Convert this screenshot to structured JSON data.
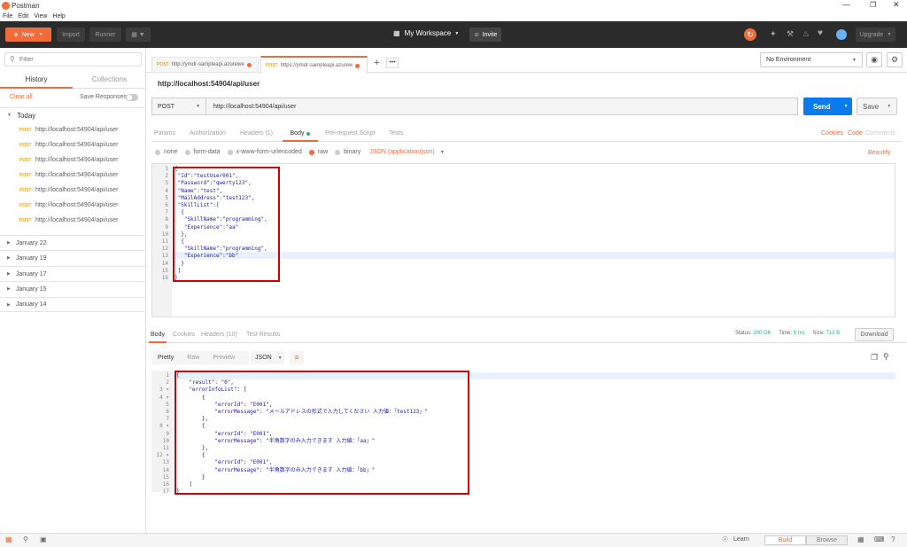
{
  "window": {
    "title": "Postman"
  },
  "menu": [
    "File",
    "Edit",
    "View",
    "Help"
  ],
  "header": {
    "new_label": "New",
    "import_label": "Import",
    "runner_label": "Runner",
    "workspace_label": "My Workspace",
    "invite_label": "Invite",
    "upgrade_label": "Upgrade"
  },
  "sidebar": {
    "search_placeholder": "Filter",
    "tabs": [
      "History",
      "Collections"
    ],
    "clear_all": "Clear all",
    "save_responses": "Save Responses",
    "today": "Today",
    "items": [
      {
        "method": "POST",
        "url": "http://localhost:54904/api/user"
      },
      {
        "method": "POST",
        "url": "http://localhost:54904/api/user"
      },
      {
        "method": "POST",
        "url": "http://localhost:54904/api/user"
      },
      {
        "method": "POST",
        "url": "http://localhost:54904/api/user"
      },
      {
        "method": "POST",
        "url": "http://localhost:54904/api/user"
      },
      {
        "method": "POST",
        "url": "http://localhost:54904/api/user"
      },
      {
        "method": "POST",
        "url": "http://localhost:54904/api/user"
      }
    ],
    "groups": [
      "January 22",
      "January 19",
      "January 17",
      "January 15",
      "January 14"
    ]
  },
  "tabs": [
    {
      "method": "POST",
      "url": "http://ymdr-sampleapi.azurewe"
    },
    {
      "method": "POST",
      "url": "https://ymdr-sampleapi.azurew"
    }
  ],
  "environment": "No Environment",
  "request": {
    "title": "http://localhost:54904/api/user",
    "method": "POST",
    "url": "http://localhost:54904/api/user",
    "send": "Send",
    "save": "Save",
    "tabs": [
      "Params",
      "Authorization",
      "Headers (1)",
      "Body",
      "Pre-request Script",
      "Tests"
    ],
    "right_links": [
      "Cookies",
      "Code",
      "Comments"
    ],
    "body_modes": [
      "none",
      "form-data",
      "x-www-form-urlencoded",
      "raw",
      "binary"
    ],
    "content_type": "JSON (application/json)",
    "beautify": "Beautify",
    "body_lines": [
      "{",
      " \"Id\":\"testUser001\",",
      " \"Password\":\"qwerty123\",",
      " \"Name\":\"test\",",
      " \"MailAddress\":\"test123\",",
      " \"SkillList\":[",
      "  {",
      "   \"SkillName\":\"programming\",",
      "   \"Experience\":\"aa\"",
      "  },",
      "  {",
      "   \"SkillName\":\"programming\",",
      "   \"Experience\":\"bb\"",
      "  }",
      " ]",
      "}"
    ]
  },
  "response": {
    "tabs": [
      "Body",
      "Cookies",
      "Headers (10)",
      "Test Results"
    ],
    "status_label": "Status:",
    "status": "200 OK",
    "time_label": "Time:",
    "time": "5 ms",
    "size_label": "Size:",
    "size": "713 B",
    "download": "Download",
    "views": [
      "Pretty",
      "Raw",
      "Preview"
    ],
    "format": "JSON",
    "body_lines": [
      "{",
      "    \"result\": \"0\",",
      "    \"errorInfoList\": [",
      "        {",
      "            \"errorId\": \"E001\",",
      "            \"errorMessage\": \"メールアドレスの形式で入力してください 入力値：「test123」\"",
      "        },",
      "        {",
      "            \"errorId\": \"E001\",",
      "            \"errorMessage\": \"半角数字のみ入力できます 入力値：「aa」\"",
      "        },",
      "        {",
      "            \"errorId\": \"E001\",",
      "            \"errorMessage\": \"半角数字のみ入力できます 入力値：「bb」\"",
      "        }",
      "    ]",
      "}"
    ]
  },
  "footer": {
    "learn": "Learn",
    "build": "Build",
    "browse": "Browse"
  },
  "colors": {
    "accent": "#f26b3a",
    "send": "#097bed",
    "highlight": "#d40000"
  }
}
